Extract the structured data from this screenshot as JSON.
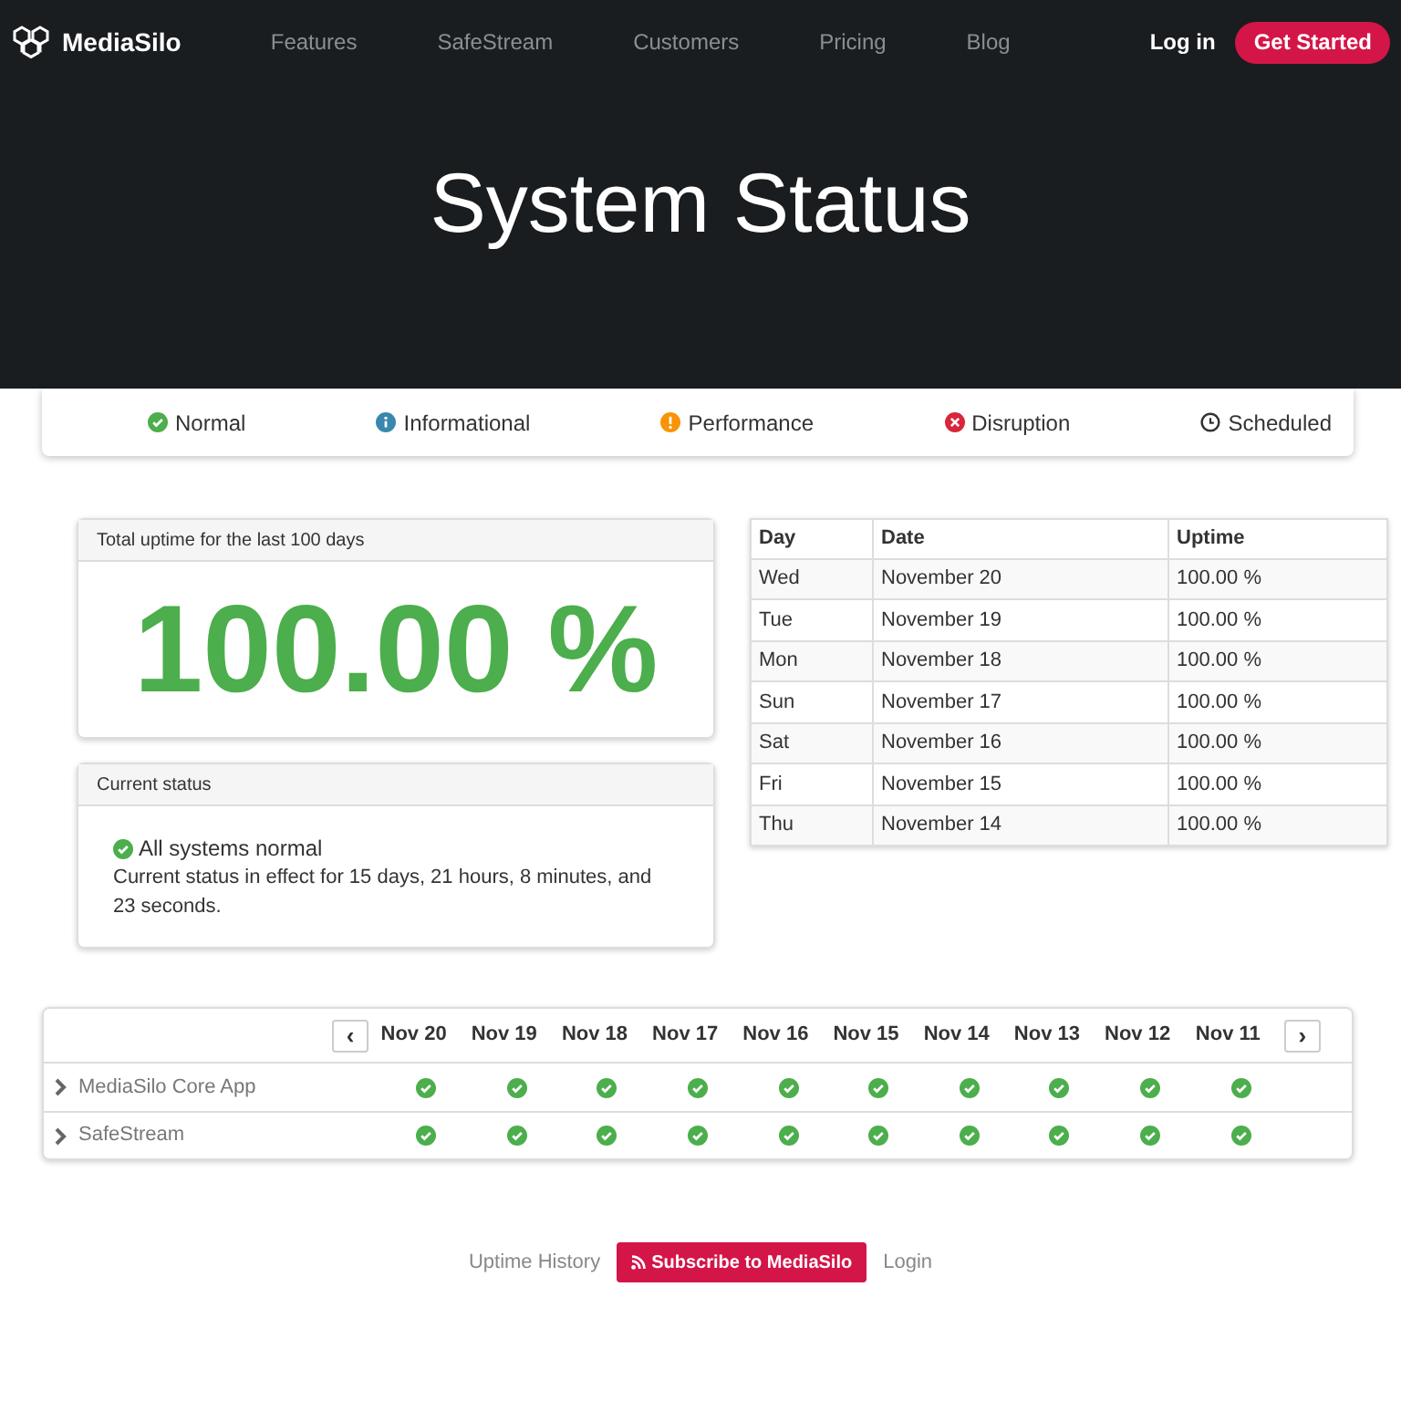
{
  "nav": {
    "brand": "MediaSilo",
    "links": [
      "Features",
      "SafeStream",
      "Customers",
      "Pricing",
      "Blog"
    ],
    "login": "Log in",
    "cta": "Get Started"
  },
  "hero": {
    "title": "System Status"
  },
  "legend": [
    {
      "kind": "normal",
      "label": "Normal",
      "color": "#4cae4c"
    },
    {
      "kind": "info",
      "label": "Informational",
      "color": "#3a87ad"
    },
    {
      "kind": "performance",
      "label": "Performance",
      "color": "#f89406"
    },
    {
      "kind": "disruption",
      "label": "Disruption",
      "color": "#d9263b"
    },
    {
      "kind": "scheduled",
      "label": "Scheduled",
      "color": "#333333"
    }
  ],
  "uptime": {
    "heading": "Total uptime for the last 100 days",
    "value": "100.00 %"
  },
  "current": {
    "heading": "Current status",
    "kind": "normal",
    "title": "All systems normal",
    "detail": "Current status in effect for 15 days, 21 hours, 8 minutes, and 23 seconds."
  },
  "table": {
    "columns": [
      "Day",
      "Date",
      "Uptime"
    ],
    "rows": [
      [
        "Wed",
        "November 20",
        "100.00 %"
      ],
      [
        "Tue",
        "November 19",
        "100.00 %"
      ],
      [
        "Mon",
        "November 18",
        "100.00 %"
      ],
      [
        "Sun",
        "November 17",
        "100.00 %"
      ],
      [
        "Sat",
        "November 16",
        "100.00 %"
      ],
      [
        "Fri",
        "November 15",
        "100.00 %"
      ],
      [
        "Thu",
        "November 14",
        "100.00 %"
      ]
    ]
  },
  "history": {
    "prev": "‹",
    "next": "›",
    "days": [
      "Nov 20",
      "Nov 19",
      "Nov 18",
      "Nov 17",
      "Nov 16",
      "Nov 15",
      "Nov 14",
      "Nov 13",
      "Nov 12",
      "Nov 11"
    ],
    "components": [
      {
        "name": "MediaSilo Core App",
        "expanded": false,
        "cells": [
          {
            "kind": "normal"
          },
          {
            "kind": "normal"
          },
          {
            "kind": "normal"
          },
          {
            "kind": "normal"
          },
          {
            "kind": "normal"
          },
          {
            "kind": "normal"
          },
          {
            "kind": "normal"
          },
          {
            "kind": "normal"
          },
          {
            "kind": "normal"
          },
          {
            "kind": "normal"
          }
        ]
      },
      {
        "name": "SafeStream",
        "expanded": false,
        "cells": [
          {
            "kind": "normal"
          },
          {
            "kind": "normal"
          },
          {
            "kind": "normal"
          },
          {
            "kind": "normal"
          },
          {
            "kind": "normal"
          },
          {
            "kind": "normal"
          },
          {
            "kind": "normal"
          },
          {
            "kind": "normal"
          },
          {
            "kind": "normal"
          },
          {
            "kind": "normal"
          }
        ]
      }
    ]
  },
  "footer": {
    "history": "Uptime History",
    "subscribe": "Subscribe to MediaSilo",
    "login": "Login"
  }
}
